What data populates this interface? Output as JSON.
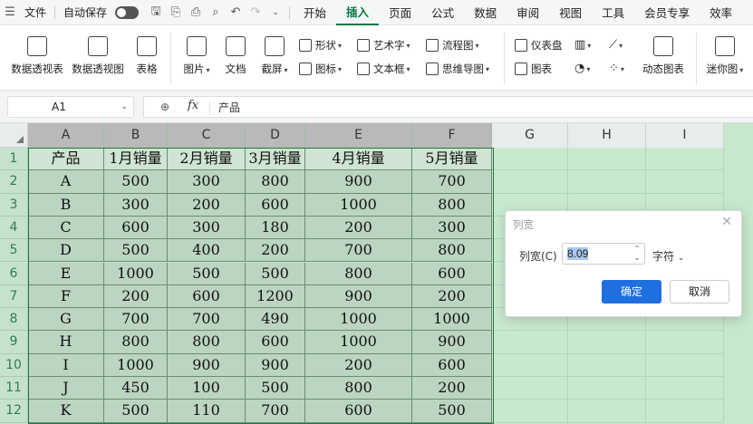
{
  "menubar": {
    "file_label": "文件",
    "autosave_label": "自动保存",
    "tabs": [
      {
        "label": "开始",
        "active": false
      },
      {
        "label": "插入",
        "active": true
      },
      {
        "label": "页面",
        "active": false
      },
      {
        "label": "公式",
        "active": false
      },
      {
        "label": "数据",
        "active": false
      },
      {
        "label": "审阅",
        "active": false
      },
      {
        "label": "视图",
        "active": false
      },
      {
        "label": "工具",
        "active": false
      },
      {
        "label": "会员专享",
        "active": false
      },
      {
        "label": "效率",
        "active": false
      }
    ],
    "accent_color": "#0a7a43"
  },
  "ribbon": {
    "pivot_table": "数据透视表",
    "pivot_chart": "数据透视图",
    "table": "表格",
    "picture": "图片",
    "document": "文档",
    "screenshot": "截屏",
    "shapes": "形状",
    "icons": "图标",
    "wordart": "艺术字",
    "textbox": "文本框",
    "flowchart": "流程图",
    "mindmap": "思维导图",
    "dashboard": "仪表盘",
    "chart": "图表",
    "dynamic_chart": "动态图表",
    "sparkline": "迷你图"
  },
  "formula_bar": {
    "name_box": "A1",
    "fx": "fx",
    "value": "产品"
  },
  "sheet": {
    "columns": [
      "A",
      "B",
      "C",
      "D",
      "E",
      "F",
      "G",
      "H",
      "I"
    ],
    "rows": [
      "1",
      "2",
      "3",
      "4",
      "5",
      "6",
      "7",
      "8",
      "9",
      "10",
      "11",
      "12"
    ],
    "header": [
      "产品",
      "1月销量",
      "2月销量",
      "3月销量",
      "4月销量",
      "5月销量"
    ],
    "data": [
      [
        "A",
        "500",
        "300",
        "800",
        "900",
        "700"
      ],
      [
        "B",
        "300",
        "200",
        "600",
        "1000",
        "800"
      ],
      [
        "C",
        "600",
        "300",
        "180",
        "200",
        "300"
      ],
      [
        "D",
        "500",
        "400",
        "200",
        "700",
        "800"
      ],
      [
        "E",
        "1000",
        "500",
        "500",
        "800",
        "600"
      ],
      [
        "F",
        "200",
        "600",
        "1200",
        "900",
        "200"
      ],
      [
        "G",
        "700",
        "700",
        "490",
        "1000",
        "1000"
      ],
      [
        "H",
        "800",
        "800",
        "600",
        "1000",
        "900"
      ],
      [
        "I",
        "1000",
        "900",
        "900",
        "200",
        "600"
      ],
      [
        "J",
        "450",
        "100",
        "500",
        "800",
        "200"
      ],
      [
        "K",
        "500",
        "110",
        "700",
        "600",
        "500"
      ]
    ]
  },
  "dialog": {
    "title": "列宽",
    "label": "列宽(C)",
    "value": "8.09",
    "unit": "字符",
    "ok": "确定",
    "cancel": "取消",
    "ok_color": "#1f6fe0"
  }
}
